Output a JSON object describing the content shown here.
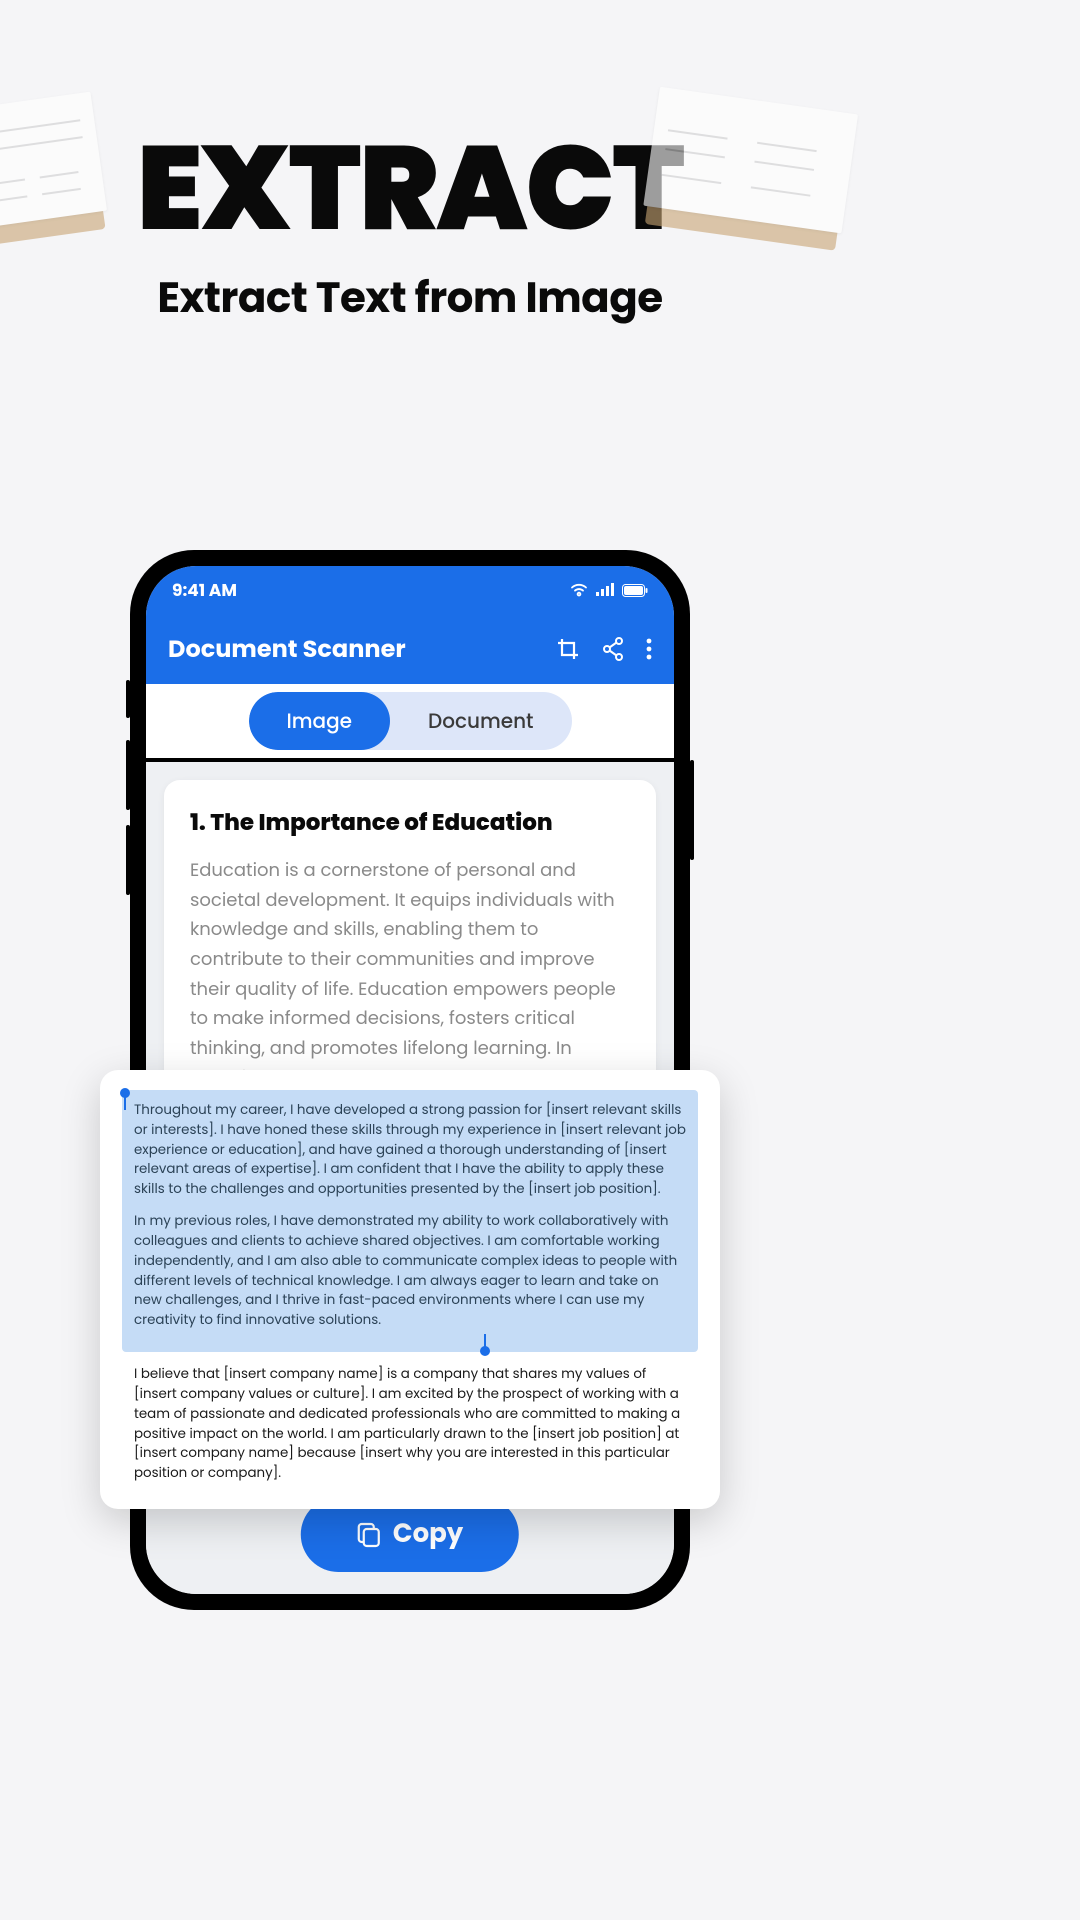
{
  "hero": {
    "title": "EXTRACT",
    "subtitle": "Extract Text from Image"
  },
  "status": {
    "time": "9:41 AM"
  },
  "appbar": {
    "title": "Document Scanner"
  },
  "tabs": {
    "image": "Image",
    "document": "Document"
  },
  "card": {
    "title": "1. The Importance of Education",
    "body": "Education is a cornerstone of personal and societal development. It equips individuals with knowledge and skills, enabling them to contribute to their communities and improve their quality of life. Education empowers people to make informed decisions, fosters critical thinking, and promotes lifelong learning. In today's rapidly changing world, the value of education cannot"
  },
  "overlay": {
    "selected_p1": "Throughout my career, I have developed a strong passion for [insert relevant skills or interests]. I have honed these skills through my experience in [insert relevant job experience or education], and have gained a thorough understanding of [insert relevant areas of expertise]. I am confident that I have the ability to apply these skills to the challenges and opportunities presented by the [insert job position].",
    "selected_p2": "In my previous roles, I have demonstrated my ability to work collaboratively with colleagues and clients to achieve shared objectives. I am comfortable working independently, and I am also able to communicate complex ideas to people with different levels of technical knowledge. I am always eager to learn and take on new challenges, and I thrive in fast-paced environments where I can use my creativity to find innovative solutions.",
    "unselected": "I believe that [insert company name] is a company that shares my values of [insert company values or culture]. I am excited by the prospect of working with a team of passionate and dedicated professionals who are committed to making a positive impact on the world. I am particularly drawn to the [insert job position] at [insert company name] because [insert why you are interested in this particular position or company]."
  },
  "copy": {
    "label": "Copy"
  }
}
